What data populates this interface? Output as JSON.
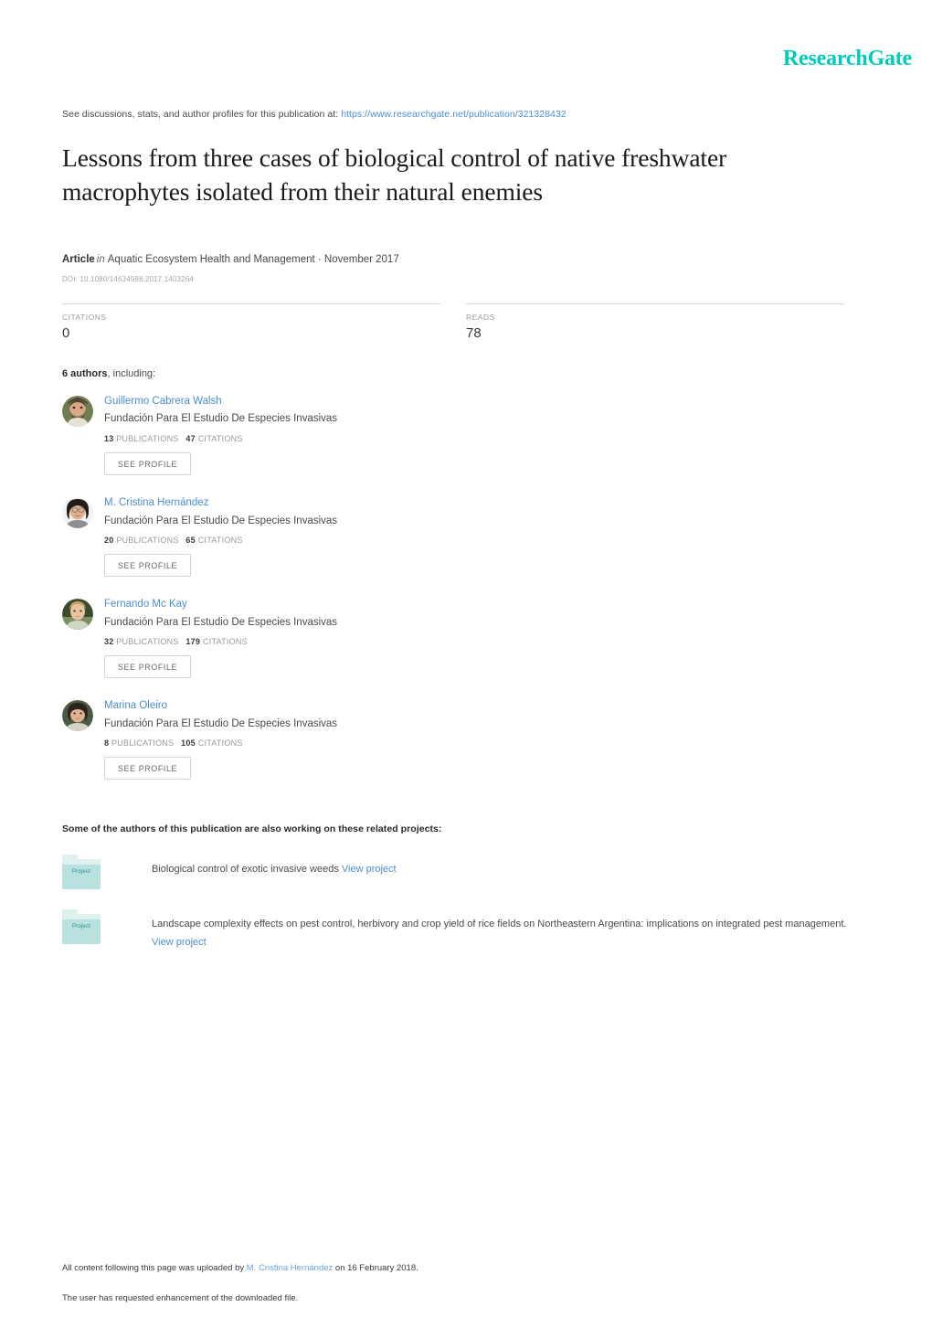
{
  "brand": {
    "logo_text": "ResearchGate",
    "logo_color": "#00ccbb"
  },
  "header": {
    "discussions_prefix": "See discussions, stats, and author profiles for this publication at:",
    "publication_url": "https://www.researchgate.net/publication/321328432"
  },
  "publication": {
    "title": "Lessons from three cases of biological control of native freshwater macrophytes isolated from their natural enemies",
    "type_label": "Article",
    "in_label": "in",
    "journal": "Aquatic Ecosystem Health and Management · November 2017",
    "doi": "DOI: 10.1080/14634988.2017.1403264"
  },
  "stats": [
    {
      "label": "CITATIONS",
      "value": "0"
    },
    {
      "label": "READS",
      "value": "78"
    }
  ],
  "authors_header": {
    "count_label": "6 authors",
    "suffix": ", including:"
  },
  "authors": [
    {
      "name": "Guillermo Cabrera Walsh",
      "affiliation": "Fundación Para El Estudio De Especies Invasivas",
      "publications_count": "13",
      "publications_label": "PUBLICATIONS",
      "citations_count": "47",
      "citations_label": "CITATIONS",
      "button_label": "SEE PROFILE"
    },
    {
      "name": "M. Cristina Hernández",
      "affiliation": "Fundación Para El Estudio De Especies Invasivas",
      "publications_count": "20",
      "publications_label": "PUBLICATIONS",
      "citations_count": "65",
      "citations_label": "CITATIONS",
      "button_label": "SEE PROFILE"
    },
    {
      "name": "Fernando Mc Kay",
      "affiliation": "Fundación Para El Estudio De Especies Invasivas",
      "publications_count": "32",
      "publications_label": "PUBLICATIONS",
      "citations_count": "179",
      "citations_label": "CITATIONS",
      "button_label": "SEE PROFILE"
    },
    {
      "name": "Marina Oleiro",
      "affiliation": "Fundación Para El Estudio De Especies Invasivas",
      "publications_count": "8",
      "publications_label": "PUBLICATIONS",
      "citations_count": "105",
      "citations_label": "CITATIONS",
      "button_label": "SEE PROFILE"
    }
  ],
  "projects": {
    "heading": "Some of the authors of this publication are also working on these related projects:",
    "icon_label": "Project",
    "items": [
      {
        "text": "Biological control of exotic invasive weeds",
        "link_label": "View project"
      },
      {
        "text": "Landscape complexity effects on pest control, herbivory and crop yield of rice fields on Northeastern Argentina: implications on integrated pest management.",
        "link_label": "View project"
      }
    ]
  },
  "footer": {
    "upload_prefix": "All content following this page was uploaded by",
    "uploader": "M. Cristina Hernández",
    "upload_suffix": "on 16 February 2018.",
    "enhancement_note": "The user has requested enhancement of the downloaded file."
  }
}
